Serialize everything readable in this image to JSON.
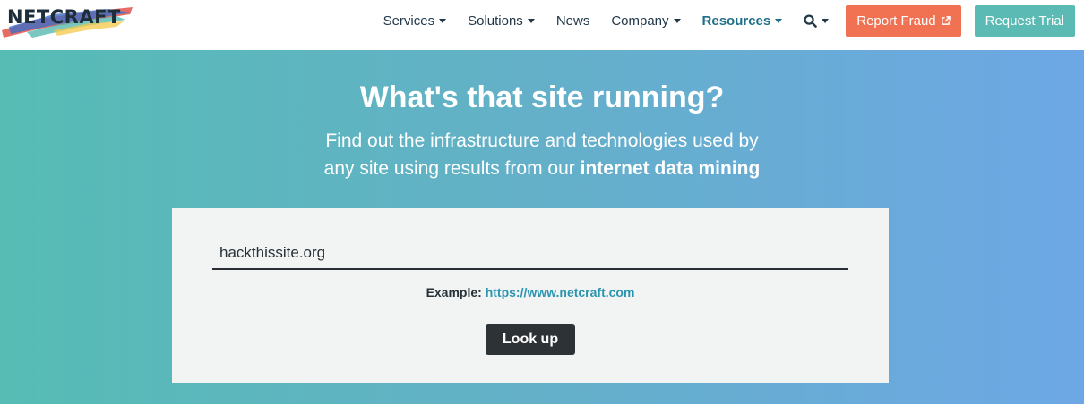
{
  "header": {
    "logo_text": "NETCRAFT",
    "nav": [
      {
        "label": "Services",
        "has_caret": true
      },
      {
        "label": "Solutions",
        "has_caret": true
      },
      {
        "label": "News",
        "has_caret": false
      },
      {
        "label": "Company",
        "has_caret": true
      },
      {
        "label": "Resources",
        "has_caret": true
      }
    ],
    "search_icon": "search-icon",
    "report_fraud_label": "Report Fraud",
    "request_trial_label": "Request Trial"
  },
  "hero": {
    "title": "What's that site running?",
    "subtitle_line1": "Find out the infrastructure and technologies used by",
    "subtitle_line2_start": "any site using results from our ",
    "subtitle_line2_bold": "internet data mining"
  },
  "lookup_form": {
    "input_value": "hackthissite.org",
    "example_label": "Example:",
    "example_link": "https://www.netcraft.com",
    "button_label": "Look up"
  },
  "colors": {
    "accent_fraud": "#f07252",
    "accent_trial": "#5bbab3",
    "hero_gradient_start": "#56bcb4",
    "hero_gradient_end": "#6da7e5"
  }
}
